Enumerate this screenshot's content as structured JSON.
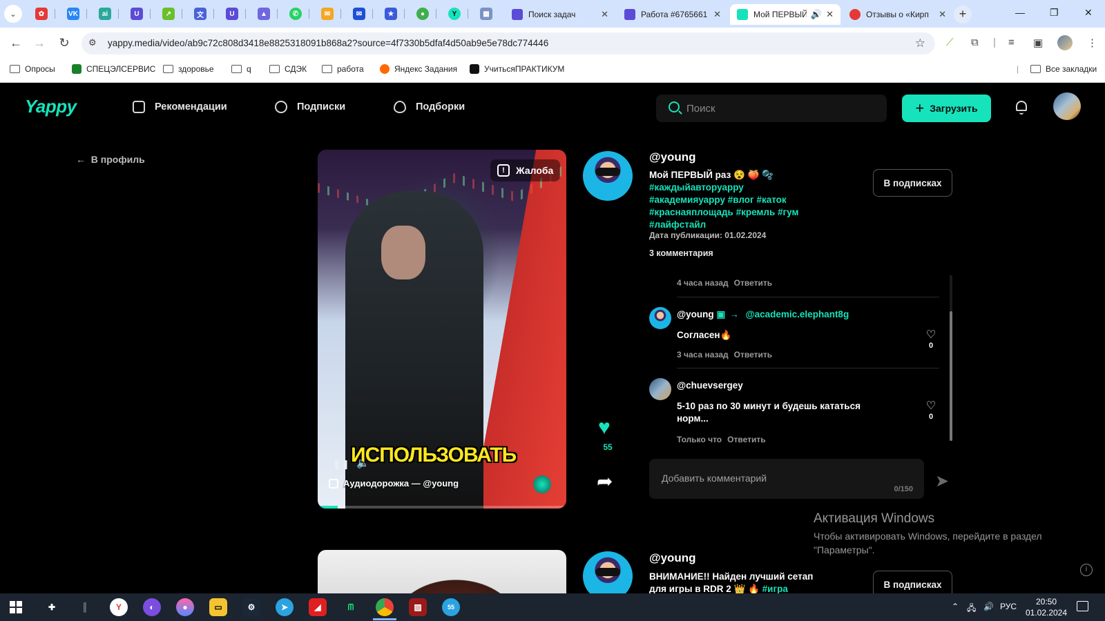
{
  "browser": {
    "tabs": [
      {
        "title": "Поиск задач",
        "color": "#5b4bd6"
      },
      {
        "title": "Работа #6765661",
        "color": "#5b4bd6"
      },
      {
        "title": "Мой ПЕРВЫЙ",
        "color": "#16e3bb",
        "active": true
      },
      {
        "title": "Отзывы о «Кирп",
        "color": "#e53935"
      }
    ],
    "pinned_icons": [
      "settings-flower",
      "vk",
      "bot",
      "ublock",
      "chart",
      "translate",
      "ublock",
      "prism",
      "whatsapp",
      "mail",
      "mail-blue",
      "star",
      "circle-green",
      "yappy",
      "maps"
    ],
    "url": "yappy.media/video/ab9c72c808d3418e8825318091b868a2?source=4f7330b5dfaf4d50ab9e5e78dc774446",
    "bookmarks": [
      {
        "label": "Опросы",
        "kind": "folder"
      },
      {
        "label": "СПЕЦЭЛСЕРВИС",
        "kind": "site",
        "color": "#1a7f2a"
      },
      {
        "label": "здоровье",
        "kind": "folder"
      },
      {
        "label": "q",
        "kind": "folder"
      },
      {
        "label": "СДЭК",
        "kind": "folder"
      },
      {
        "label": "работа",
        "kind": "folder"
      },
      {
        "label": "Яндекс Задания",
        "kind": "site",
        "color": "#ff6a00"
      },
      {
        "label": "УчитьсяПРАКТИКУМ",
        "kind": "site",
        "color": "#111111"
      }
    ],
    "all_bookmarks": "Все закладки"
  },
  "app": {
    "logo": "Yappy",
    "accent": "#16e3bb",
    "nav": [
      "Рекомендации",
      "Подписки",
      "Подборки"
    ],
    "search_placeholder": "Поиск",
    "upload_label": "Загрузить",
    "back_label": "В профиль"
  },
  "post": {
    "complaint": "Жалоба",
    "video_caption": "ИСПОЛЬЗОВАТЬ",
    "audio": "Аудиодорожка — @young",
    "progress": 0.08,
    "author": "@young",
    "title": "Мой ПЕРВЫЙ раз 😵 🍑 🫧",
    "hashtags": [
      "#каждыйавторуарру",
      "#академияуарру",
      "#влог",
      "#каток",
      "#краснаяплощадь",
      "#кремль",
      "#гум",
      "#лайфстайл"
    ],
    "pub_date": "Дата публикации: 01.02.2024",
    "comment_count": "3 комментария",
    "subscribe_label": "В подписках",
    "likes": "55",
    "comments": [
      {
        "partial": true,
        "time": "4 часа назад",
        "reply": "Ответить"
      },
      {
        "author": "@young",
        "to": "@academic.elephant8g",
        "text": "Согласен🔥",
        "likes": "0",
        "time": "3 часа назад",
        "reply": "Ответить"
      },
      {
        "author": "@chuevsergey",
        "text": "5-10 раз по 30 минут и будешь кататься норм...",
        "likes": "0",
        "time": "Только что",
        "reply": "Ответить"
      }
    ],
    "comment_placeholder": "Добавить комментарий",
    "comment_counter": "0/150"
  },
  "next_post": {
    "author": "@young",
    "text": "ВНИМАНИЕ!! Найден лучший сетап для игры в RDR 2 👑 🔥",
    "tag": "#игра",
    "subscribe_label": "В подписках"
  },
  "watermark": {
    "title": "Активация Windows",
    "text": "Чтобы активировать Windows, перейдите в раздел \"Параметры\"."
  },
  "taskbar": {
    "lang": "РУС",
    "time": "20:50",
    "date": "01.02.2024",
    "telegram_badge": "55"
  }
}
